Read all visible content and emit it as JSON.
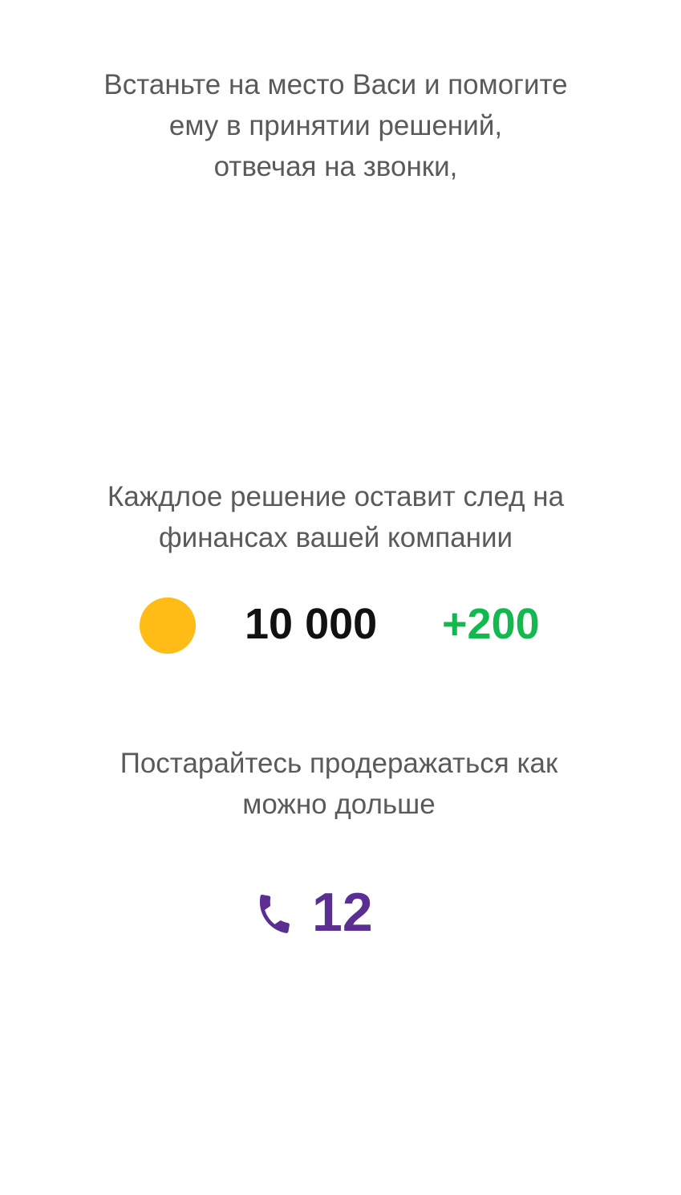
{
  "onboarding": {
    "intro": {
      "line1": "Встаньте на место Васи и помогите",
      "line2": "ему в принятии решений,",
      "line3": "отвечая на звонки,"
    },
    "finance_hint": {
      "line1": "Каждлое решение оставит след на",
      "line2": "финансах вашей компании"
    },
    "finance": {
      "coin_icon": "coin-icon",
      "balance": "10 000",
      "delta": "+200"
    },
    "survival_hint": {
      "line1": "Постарайтесь продеражаться как",
      "line2": "можно дольше"
    },
    "calls": {
      "icon": "phone-icon",
      "count": "12"
    }
  },
  "colors": {
    "text": "#5a5a5a",
    "coin": "#ffbb16",
    "balance": "#111111",
    "delta": "#13b84f",
    "calls": "#5b2e91",
    "background": "#ffffff"
  }
}
